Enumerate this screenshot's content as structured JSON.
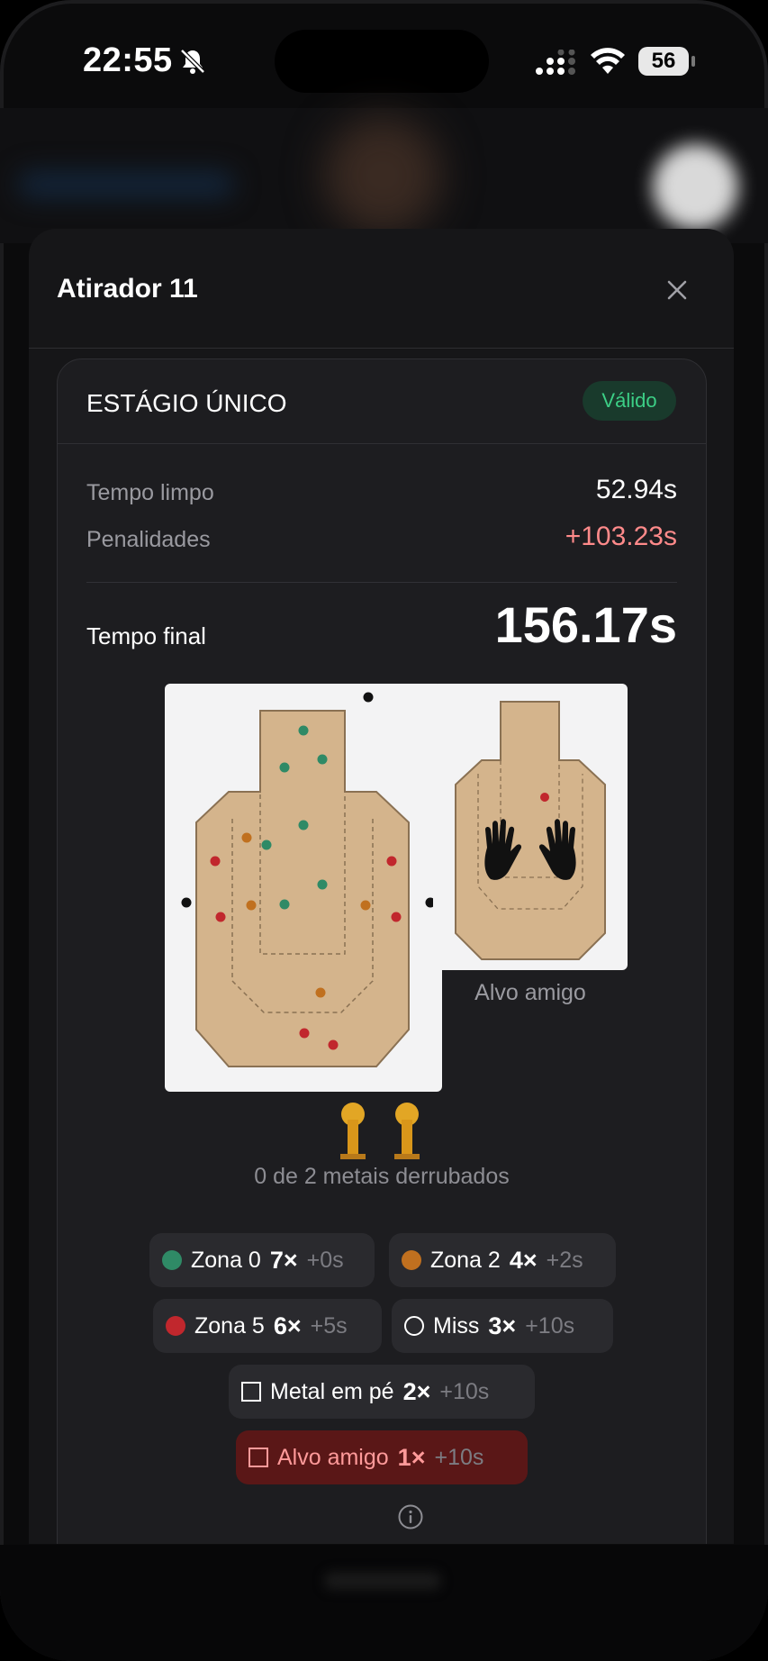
{
  "status_bar": {
    "time": "22:55",
    "battery": "56",
    "icons": [
      "bell-slash-icon",
      "signal-icon",
      "wifi-icon",
      "battery-icon"
    ]
  },
  "sheet": {
    "title": "Atirador 11",
    "close_icon": "close-icon"
  },
  "stage": {
    "title": "ESTÁGIO ÚNICO",
    "status_badge": "Válido",
    "badge_color": "#3ccf86",
    "clean_time_label": "Tempo limpo",
    "clean_time_value": "52.94s",
    "penalties_label": "Penalidades",
    "penalties_value": "+103.23s",
    "penalty_color": "#ff8a8a",
    "final_time_label": "Tempo final",
    "final_time_value": "156.17s"
  },
  "targets": {
    "friend_caption": "Alvo amigo",
    "metals_caption": "0 de 2 metais derrubados",
    "colors": {
      "zone0": "#2f8a66",
      "zone2": "#c0701f",
      "zone5": "#c1272d",
      "miss": "#111111"
    }
  },
  "legend": [
    {
      "label": "Zona 0",
      "count": "7×",
      "points": "+0s",
      "marker": "dot",
      "color": "#2f8a66"
    },
    {
      "label": "Zona 2",
      "count": "4×",
      "points": "+2s",
      "marker": "dot",
      "color": "#c0701f"
    },
    {
      "label": "Zona 5",
      "count": "6×",
      "points": "+5s",
      "marker": "dot",
      "color": "#c1272d"
    },
    {
      "label": "Miss",
      "count": "3×",
      "points": "+10s",
      "marker": "ring",
      "color": "#ffffff"
    },
    {
      "label": "Metal em pé",
      "count": "2×",
      "points": "+10s",
      "marker": "square",
      "color": "#ffffff"
    },
    {
      "label": "Alvo amigo",
      "count": "1×",
      "points": "+10s",
      "marker": "square",
      "color": "#ff9a9a"
    }
  ],
  "info_icon": "info-icon"
}
